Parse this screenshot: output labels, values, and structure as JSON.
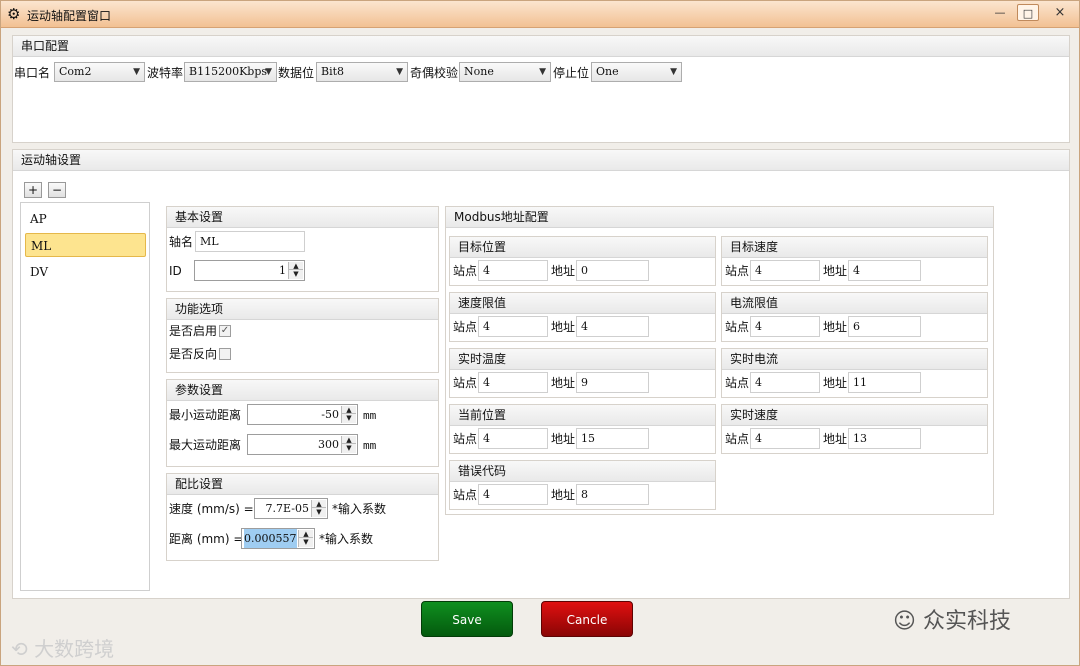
{
  "window": {
    "title": "运动轴配置窗口",
    "min": "—",
    "max": "□",
    "close": "×"
  },
  "serial": {
    "title": "串口配置",
    "port_label": "串口名",
    "port_value": "Com2",
    "baud_label": "波特率",
    "baud_value": "B115200Kbps",
    "databits_label": "数据位",
    "databits_value": "Bit8",
    "parity_label": "奇偶校验",
    "parity_value": "None",
    "stop_label": "停止位",
    "stop_value": "One"
  },
  "axis": {
    "title": "运动轴设置",
    "add_label": "+",
    "remove_label": "−",
    "items": [
      "AP",
      "ML",
      "DV"
    ],
    "selected": "ML"
  },
  "basic": {
    "title": "基本设置",
    "name_label": "轴名",
    "name_value": "ML",
    "id_label": "ID",
    "id_value": "1"
  },
  "func": {
    "title": "功能选项",
    "enable_label": "是否启用",
    "enable_checked": true,
    "reverse_label": "是否反向",
    "reverse_checked": false
  },
  "params": {
    "title": "参数设置",
    "min_label": "最小运动距离",
    "min_value": "-50",
    "max_label": "最大运动距离",
    "max_value": "300",
    "unit": "mm"
  },
  "ratio": {
    "title": "配比设置",
    "speed_label": "速度 (mm/s) =",
    "speed_value": "7.7E-05",
    "speed_suffix": "*输入系数",
    "dist_label": "距离 (mm) =",
    "dist_value": "0.000557",
    "dist_suffix": "*输入系数"
  },
  "modbus": {
    "title": "Modbus地址配置",
    "station_label": "站点",
    "address_label": "地址",
    "blocks": [
      {
        "title": "目标位置",
        "station": "4",
        "address": "0"
      },
      {
        "title": "目标速度",
        "station": "4",
        "address": "4"
      },
      {
        "title": "速度限值",
        "station": "4",
        "address": "4"
      },
      {
        "title": "电流限值",
        "station": "4",
        "address": "6"
      },
      {
        "title": "实时温度",
        "station": "4",
        "address": "9"
      },
      {
        "title": "实时电流",
        "station": "4",
        "address": "11"
      },
      {
        "title": "当前位置",
        "station": "4",
        "address": "15"
      },
      {
        "title": "实时速度",
        "station": "4",
        "address": "13"
      },
      {
        "title": "错误代码",
        "station": "4",
        "address": "8"
      }
    ]
  },
  "actions": {
    "save": "Save",
    "cancel": "Cancle"
  },
  "watermarks": {
    "left": "大数跨境",
    "right": "众实科技"
  }
}
